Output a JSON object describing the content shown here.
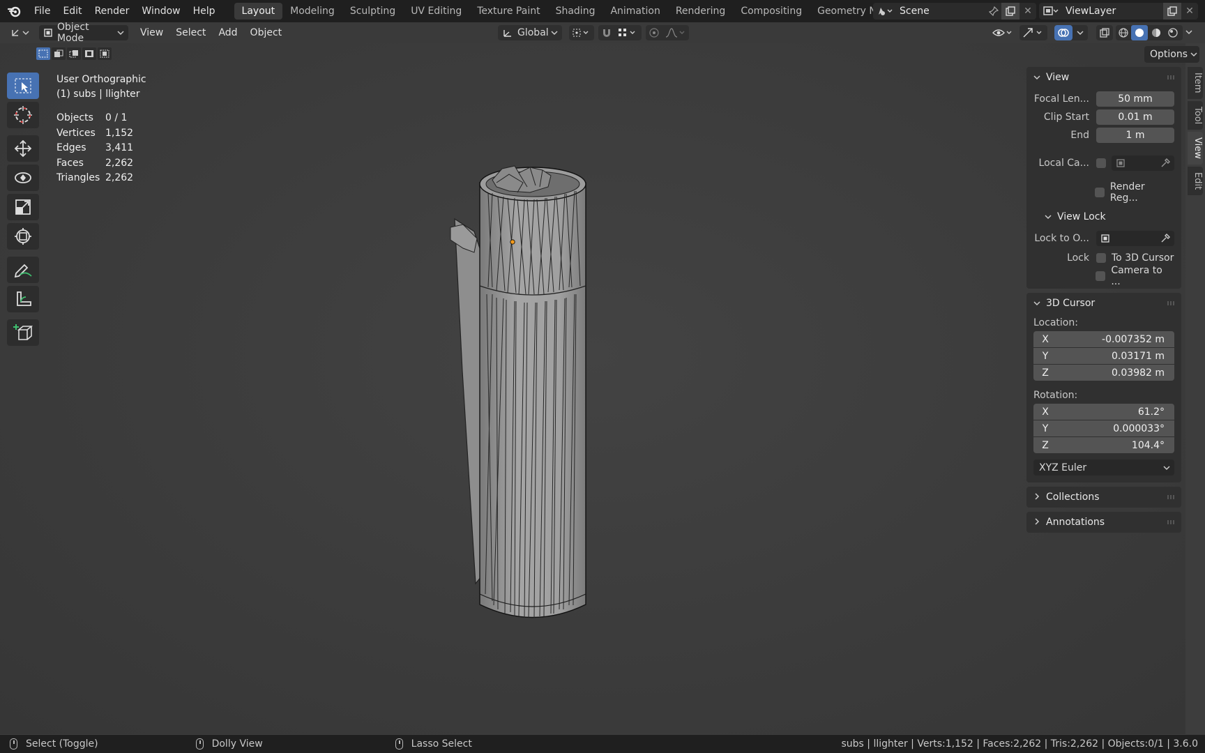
{
  "menu": {
    "file": "File",
    "edit": "Edit",
    "render": "Render",
    "window": "Window",
    "help": "Help"
  },
  "workspaces": [
    "Layout",
    "Modeling",
    "Sculpting",
    "UV Editing",
    "Texture Paint",
    "Shading",
    "Animation",
    "Rendering",
    "Compositing",
    "Geometry Nodes"
  ],
  "scene": {
    "name": "Scene",
    "view_layer": "ViewLayer"
  },
  "header": {
    "mode": "Object Mode",
    "view": "View",
    "select": "Select",
    "add": "Add",
    "object": "Object",
    "orientation": "Global",
    "options": "Options"
  },
  "viewport": {
    "view_name": "User Orthographic",
    "object_info": "(1) subs | llighter",
    "stats": [
      {
        "key": "Objects",
        "value": "0 / 1"
      },
      {
        "key": "Vertices",
        "value": "1,152"
      },
      {
        "key": "Edges",
        "value": "3,411"
      },
      {
        "key": "Faces",
        "value": "2,262"
      },
      {
        "key": "Triangles",
        "value": "2,262"
      }
    ]
  },
  "npanel": {
    "tabs": [
      "Item",
      "Tool",
      "View",
      "Edit"
    ],
    "view": {
      "title": "View",
      "focal_label": "Focal Len...",
      "focal_value": "50 mm",
      "clip_start_label": "Clip Start",
      "clip_start_value": "0.01 m",
      "end_label": "End",
      "end_value": "1 m",
      "local_camera_label": "Local Ca...",
      "render_region_label": "Render Reg..."
    },
    "view_lock": {
      "title": "View Lock",
      "lock_to_label": "Lock to O...",
      "lock_label": "Lock",
      "to_cursor": "To 3D Cursor",
      "camera_to": "Camera to ..."
    },
    "cursor": {
      "title": "3D Cursor",
      "location_label": "Location:",
      "loc": [
        {
          "axis": "X",
          "value": "-0.007352 m"
        },
        {
          "axis": "Y",
          "value": "0.03171 m"
        },
        {
          "axis": "Z",
          "value": "0.03982 m"
        }
      ],
      "rotation_label": "Rotation:",
      "rot": [
        {
          "axis": "X",
          "value": "61.2°"
        },
        {
          "axis": "Y",
          "value": "0.000033°"
        },
        {
          "axis": "Z",
          "value": "104.4°"
        }
      ],
      "rotation_mode": "XYZ Euler"
    },
    "collections": "Collections",
    "annotations": "Annotations"
  },
  "status": {
    "left": "Select (Toggle)",
    "middle": "Dolly View",
    "right": "Lasso Select",
    "info": "subs | llighter | Verts:1,152 | Faces:2,262 | Tris:2,262 | Objects:0/1 | 3.6.0"
  },
  "colors": {
    "accent": "#4772b3",
    "topbar": "#1f1f1f",
    "viewport": "#3d3d3d",
    "origin": "#f29b1d"
  }
}
